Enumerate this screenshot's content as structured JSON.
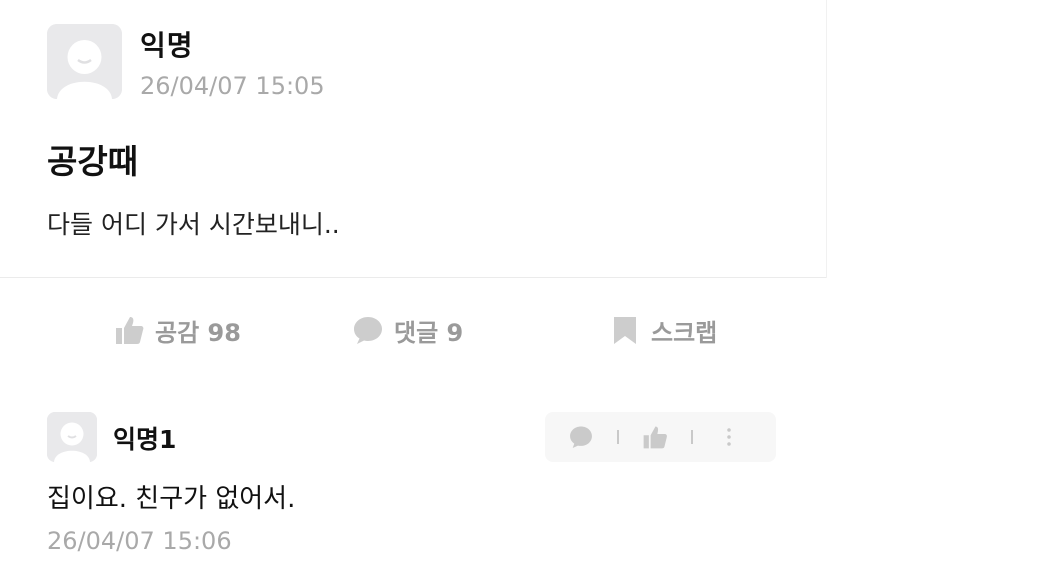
{
  "post": {
    "author": "익명",
    "date": "26/04/07 15:05",
    "title": "공강때",
    "body": "다들 어디 가서 시간보내니..",
    "avatar_icon": "default-avatar-icon"
  },
  "actions": {
    "like": {
      "label": "공감 98",
      "icon": "thumbs-up-icon"
    },
    "comment": {
      "label": "댓글 9",
      "icon": "speech-bubble-icon"
    },
    "scrap": {
      "label": "스크랩",
      "icon": "bookmark-icon"
    }
  },
  "comment": {
    "author": "익명1",
    "body": "집이요. 친구가 없어서.",
    "date": "26/04/07 15:06",
    "tools": [
      "reply-icon",
      "thumbs-up-icon",
      "more-vertical-icon"
    ]
  },
  "colors": {
    "text": "#111111",
    "muted": "#a9a9a9",
    "icon": "#c4c4c4",
    "avatar_bg": "#e9e9eb"
  }
}
